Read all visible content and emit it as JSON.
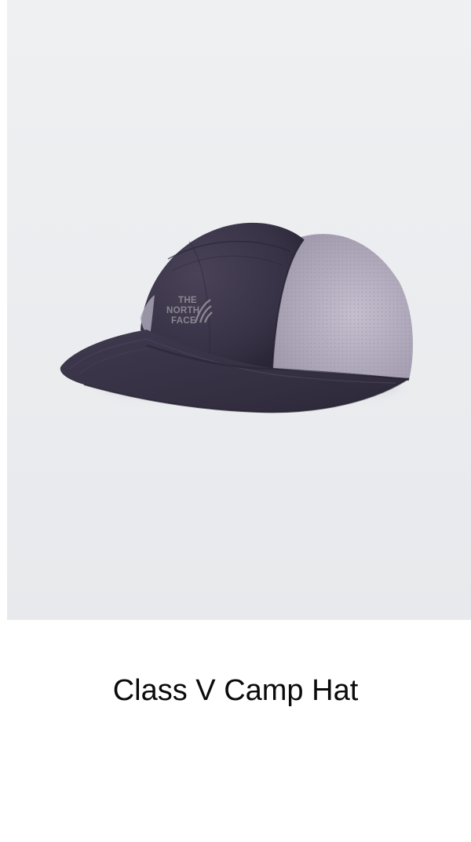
{
  "product": {
    "title": "Class V Camp Hat",
    "image": {
      "subject": "camp-hat",
      "brand_logo_lines": [
        "THE",
        "NORTH",
        "FACE"
      ],
      "colors": {
        "background": "#e9ebee",
        "crown": "#383246",
        "brim": "#353044",
        "mesh": "#b1aabd",
        "logo": "#8b8490"
      }
    }
  }
}
